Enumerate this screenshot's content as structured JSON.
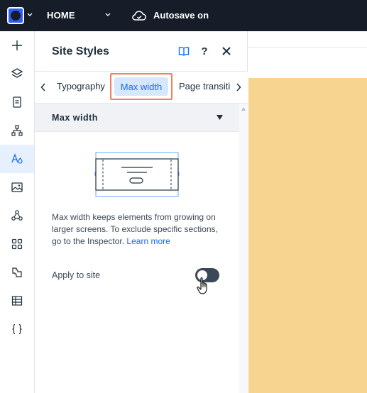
{
  "topbar": {
    "page_name": "HOME",
    "autosave": "Autosave on"
  },
  "rail": {
    "items": [
      "add-icon",
      "layers-icon",
      "pages-icon",
      "site-structure-icon",
      "site-styles-icon",
      "media-icon",
      "apps-network-icon",
      "app-market-icon",
      "integrations-icon",
      "cms-table-icon",
      "code-icon"
    ],
    "active": "site-styles-icon"
  },
  "panel": {
    "title": "Site Styles",
    "tabs": [
      "Typography",
      "Max width",
      "Page transiti"
    ],
    "selected_tab": "Max width",
    "section_title": "Max width",
    "description": "Max width keeps elements from growing on larger screens. To exclude specific sections, go to the Inspector.",
    "learn_more": "Learn more",
    "apply_label": "Apply to site",
    "apply_toggle_on": false
  },
  "colors": {
    "topbar_bg": "#161c28",
    "accent": "#116dff",
    "selected_tab_bg": "#d7e7ff",
    "highlight_frame": "#f47e5c",
    "canvas_fill": "#f8d491",
    "toggle_bg": "#3b4857"
  }
}
